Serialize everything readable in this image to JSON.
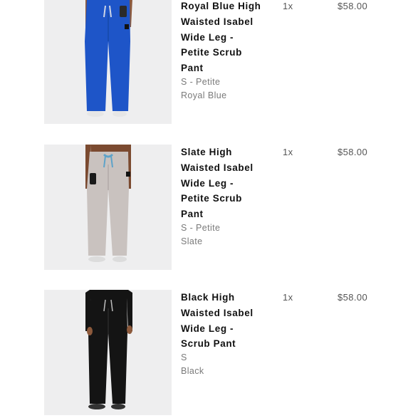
{
  "items": [
    {
      "title": "Royal Blue High Waisted Isabel Wide Leg - Petite Scrub Pant",
      "size": "S - Petite",
      "color": "Royal Blue",
      "quantity": "1x",
      "price": "$58.00",
      "swatch": "#1e55c8"
    },
    {
      "title": "Slate High Waisted Isabel Wide Leg - Petite Scrub Pant",
      "size": "S - Petite",
      "color": "Slate",
      "quantity": "1x",
      "price": "$58.00",
      "swatch": "#c9c2bf"
    },
    {
      "title": "Black High Waisted Isabel Wide Leg - Scrub Pant",
      "size": "S",
      "color": "Black",
      "quantity": "1x",
      "price": "$58.00",
      "swatch": "#141414"
    }
  ]
}
